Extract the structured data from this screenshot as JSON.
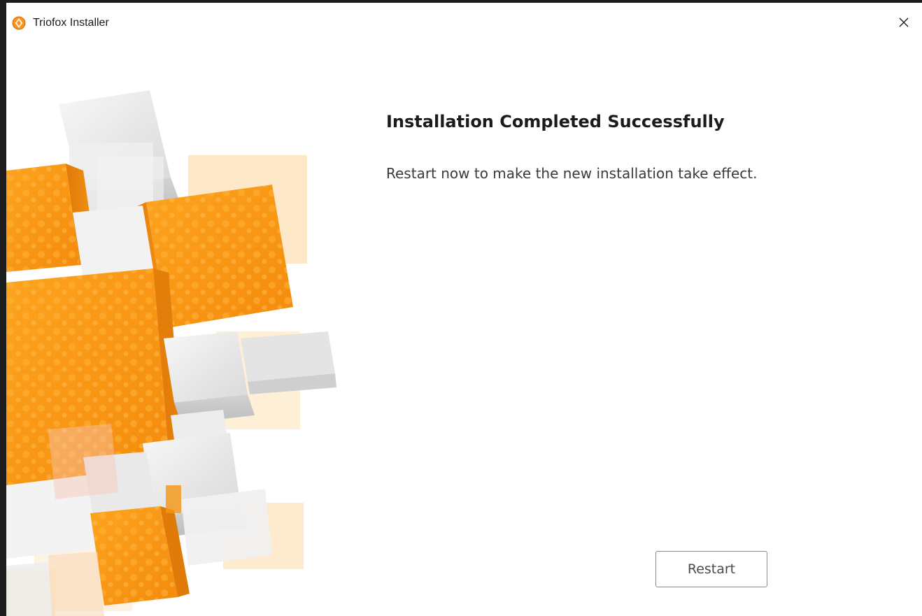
{
  "window": {
    "title": "Triofox Installer",
    "app_icon": "triofox-logo-icon",
    "close_icon": "close-icon"
  },
  "content": {
    "heading": "Installation Completed Successfully",
    "message": "Restart now to make the new installation take effect."
  },
  "actions": {
    "restart_label": "Restart"
  },
  "colors": {
    "accent_orange": "#f7941d",
    "light_orange": "#fdd9a3",
    "cube_gray": "#e6e6e6",
    "window_border": "#1c1c1c"
  }
}
